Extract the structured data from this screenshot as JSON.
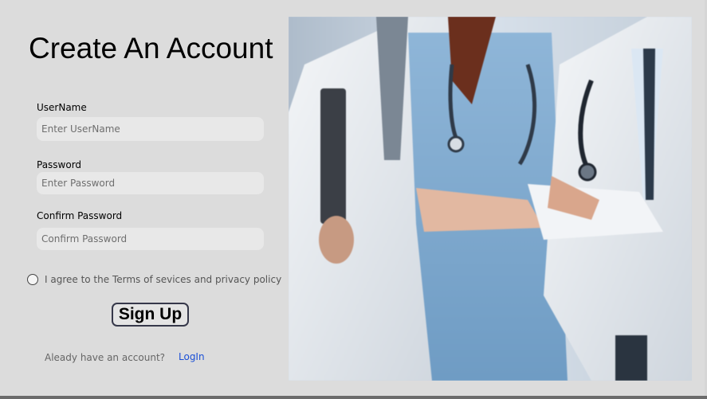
{
  "page": {
    "title": "Create An Account"
  },
  "form": {
    "username": {
      "label": "UserName",
      "placeholder": "Enter UserName",
      "value": ""
    },
    "password": {
      "label": "Password",
      "placeholder": "Enter Password",
      "value": ""
    },
    "confirm_password": {
      "label": "Confirm Password",
      "placeholder": "Confirm Password",
      "value": ""
    },
    "agree": {
      "label": "I agree to the Terms of sevices and privacy policy",
      "checked": false
    },
    "submit_label": "Sign Up"
  },
  "footer": {
    "prompt": "Aleady have an account?",
    "login_label": "LogIn"
  },
  "hero": {
    "description_icon": "medical-staff-image"
  },
  "colors": {
    "background": "#dcdcdc",
    "input_background": "#e8e8e8",
    "link": "#1a4fd6",
    "button_border": "#36384a"
  }
}
